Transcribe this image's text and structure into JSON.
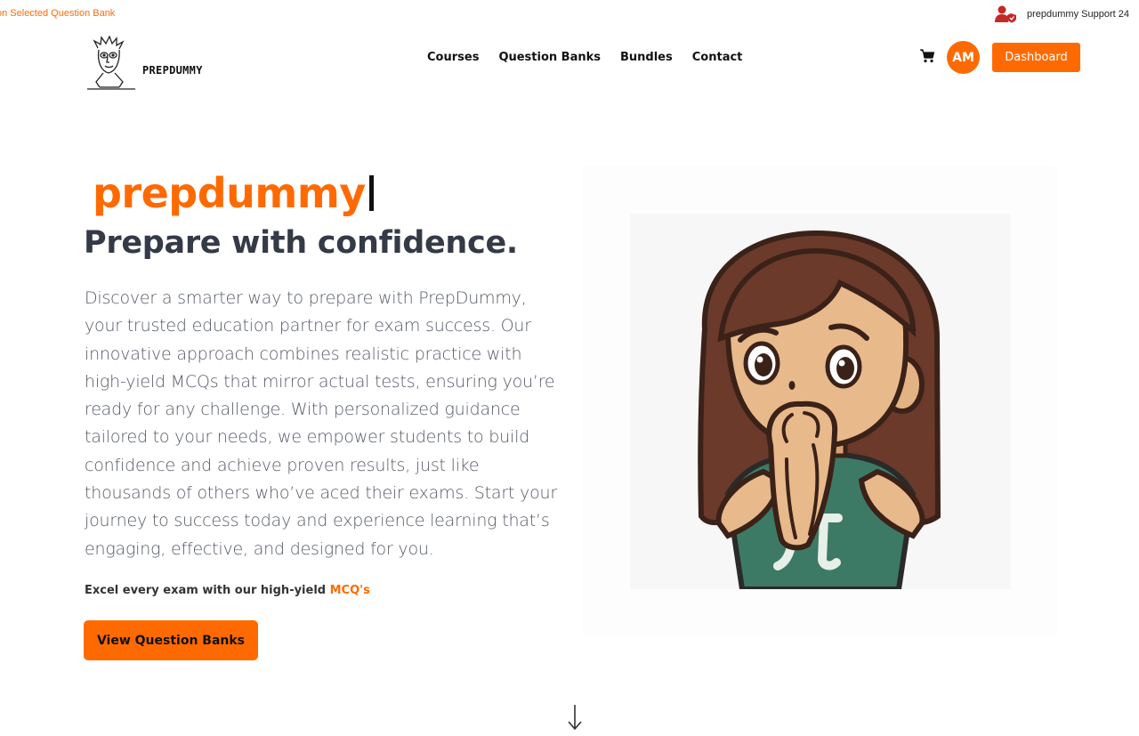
{
  "topbar": {
    "ticker": "on Selected Question Bank",
    "support_text": "prepdummy Support 24",
    "support_icon": "user-shield-icon"
  },
  "nav": {
    "logo_text": "PREPDUMMY",
    "menu": [
      {
        "label": "Courses"
      },
      {
        "label": "Question Banks"
      },
      {
        "label": "Bundles"
      },
      {
        "label": "Contact"
      }
    ],
    "cart_icon": "cart-icon",
    "avatar_initials": "AM",
    "dashboard_label": "Dashboard"
  },
  "hero": {
    "brand": "prepdummy",
    "headline": "Prepare with confidence.",
    "description": "Discover a smarter way to prepare with PrepDummy, your trusted education partner for exam success. Our innovative approach combines realistic practice with high-yield MCQs that mirror actual tests, ensuring you’re ready for any challenge. With personalized guidance tailored to your needs, we empower students to build confidence and achieve proven results, just like thousands of others who’ve aced their exams. Start your journey to success today and experience learning that’s engaging, effective, and designed for you.",
    "excel_text": "Excel every exam with our high-yield ",
    "excel_accent": "MCQ's",
    "cta_label": "View Question Banks",
    "scroll_icon": "arrow-down-icon"
  },
  "colors": {
    "accent": "#ff6a00",
    "heading": "#343a46",
    "body": "#555a66"
  }
}
